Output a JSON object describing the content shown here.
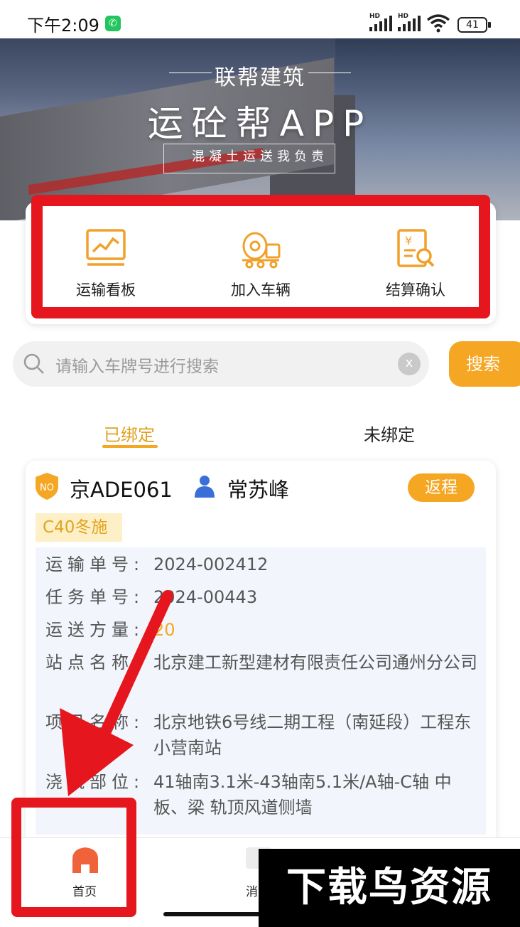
{
  "status_bar": {
    "time": "下午2:09",
    "signal_label_1": "HD",
    "signal_label_2": "HD",
    "battery": "41"
  },
  "banner": {
    "brand": "联帮建筑",
    "app_title": "运砼帮APP",
    "slogan": "混凝土运送我负责"
  },
  "quick_actions": [
    {
      "label": "运输看板",
      "icon": "chart-board-icon"
    },
    {
      "label": "加入车辆",
      "icon": "mixer-truck-icon"
    },
    {
      "label": "结算确认",
      "icon": "settlement-search-icon"
    }
  ],
  "search": {
    "placeholder": "请输入车牌号进行搜索",
    "clear_label": "x",
    "button_label": "搜索"
  },
  "tabs": {
    "bound": "已绑定",
    "unbound": "未绑定"
  },
  "vehicle": {
    "badge": "NO",
    "plate": "京ADE061",
    "driver": "常苏峰",
    "status": "返程",
    "grade": "C40冬施",
    "fields": [
      {
        "key": "运输单号:",
        "value": "2024-002412"
      },
      {
        "key": "任务单号:",
        "value": "2024-00443"
      },
      {
        "key": "运送方量:",
        "value": "20"
      },
      {
        "key": "站点名称:",
        "value": "北京建工新型建材有限责任公司通州分公司"
      },
      {
        "key": "项目名称:",
        "value": "北京地铁6号线二期工程（南延段）工程东小营南站"
      },
      {
        "key": "浇筑部位:",
        "value": "41轴南3.1米-43轴南5.1米/A轴-C轴 中板、梁 轨顶风道侧墙"
      }
    ]
  },
  "bottom_nav": {
    "home": "首页",
    "messages": "消"
  },
  "watermark": "下载鸟资源",
  "colors": {
    "accent": "#f5a623",
    "highlight_red": "#e5161d",
    "nav_home_icon": "#f0623a"
  }
}
